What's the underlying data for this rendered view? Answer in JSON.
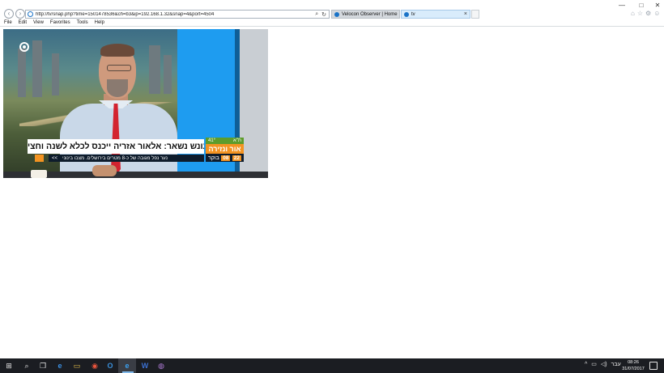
{
  "browser": {
    "url": "http://tv/snap.php?time=1501478536&ch=b3&ip=192.168.1.32&snap=4&port=4504",
    "tabs": [
      {
        "label": "Velocon Observer | Home",
        "active": false
      },
      {
        "label": "tv",
        "active": true
      }
    ],
    "back_glyph": "‹",
    "forward_glyph": "›",
    "search_glyph": "⌕",
    "refresh_glyph": "↻",
    "close_tab_glyph": "×",
    "win_min": "—",
    "win_max": "□",
    "win_close": "✕",
    "home_glyph": "⌂",
    "star_glyph": "☆",
    "gear_glyph": "⚙",
    "smile_glyph": "☺"
  },
  "menu": [
    {
      "label": "File"
    },
    {
      "label": "Edit"
    },
    {
      "label": "View"
    },
    {
      "label": "Favorites"
    },
    {
      "label": "Tools"
    },
    {
      "label": "Help"
    }
  ],
  "video": {
    "headline": "הערעור נדחה, העונש נשאר: אלאור אזריה ייכנס לכלא לשנה וחצי",
    "subline_arrow": "<<",
    "subline": "נער נפל מגובה של כ-8 מטרים בירושלים. מצבו בינוני",
    "brand_city": "ת\"א",
    "brand_temp": "41°",
    "brand_name": "אור ונזירה",
    "brand_bottom_num": "22",
    "brand_bottom_unit": "08",
    "brand_bottom_word": "בוקר"
  },
  "taskbar": {
    "start_glyph": "⊞",
    "search_glyph": "⌕",
    "task_glyph": "❐",
    "edge_glyph": "e",
    "explorer_glyph": "▭",
    "chrome_glyph": "◉",
    "outlook_glyph": "O",
    "ie_glyph": "e",
    "word_glyph": "W",
    "other_glyph": "◍",
    "tray_chevron": "^",
    "tray_network": "▭",
    "tray_volume": "◁)",
    "tray_lang": "עבר",
    "time": "08:26",
    "date": "31/07/2017"
  }
}
